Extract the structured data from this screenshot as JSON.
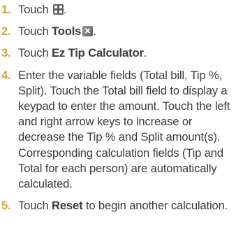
{
  "steps": [
    {
      "number": "1.",
      "before": "Touch ",
      "icon": "apps-icon",
      "after": "."
    },
    {
      "number": "2.",
      "before": "Touch ",
      "bold": "Tools",
      "icon": "tools-icon",
      "after": "."
    },
    {
      "number": "3.",
      "before": "Touch ",
      "bold": "Ez Tip Calculator",
      "after": "."
    },
    {
      "number": "4.",
      "text": "Enter the variable fields (Total bill, Tip %, Split). Touch the Total bill field to display a keypad to enter the amount.  Touch the left and right arrow keys to increase or decrease the Tip % and Split amount(s). Corresponding calculation fields (Tip and Total for each person) are automatically calculated."
    },
    {
      "number": "5.",
      "before": "Touch ",
      "bold": "Reset",
      "after": " to begin another calculation."
    }
  ],
  "colors": {
    "number": "#d3a23b",
    "text": "#3a3a3a"
  }
}
